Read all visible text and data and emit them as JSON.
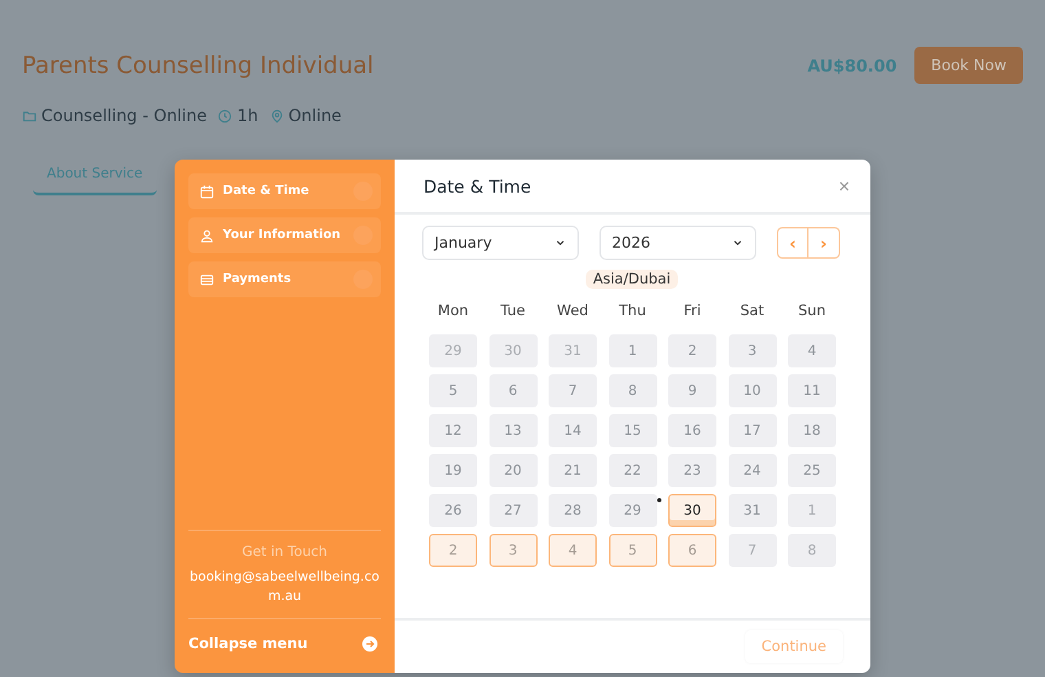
{
  "service": {
    "title": "Parents Counselling Individual",
    "price": "AU$80.00",
    "book_button": "Book Now",
    "category": "Counselling - Online",
    "duration": "1h",
    "location": "Online"
  },
  "tabs": [
    {
      "label": "About Service",
      "selected": true
    }
  ],
  "steps": [
    {
      "label": "Date & Time"
    },
    {
      "label": "Your Information"
    },
    {
      "label": "Payments"
    }
  ],
  "contact": {
    "heading": "Get in Touch",
    "email": "booking@sabeelwellbeing.com.au"
  },
  "collapse": {
    "label": "Collapse menu"
  },
  "panel": {
    "title": "Date & Time",
    "close": "×",
    "month": "January",
    "year": "2026",
    "timezone": "Asia/Dubai",
    "prev": "‹",
    "next": "›",
    "continue": "Continue"
  },
  "weekdays": [
    "Mon",
    "Tue",
    "Wed",
    "Thu",
    "Fri",
    "Sat",
    "Sun"
  ],
  "days": [
    {
      "day": "29",
      "kind": "faded",
      "selected": false,
      "today": false
    },
    {
      "day": "30",
      "kind": "faded",
      "selected": false,
      "today": false
    },
    {
      "day": "31",
      "kind": "faded",
      "selected": false,
      "today": false
    },
    {
      "day": "1",
      "kind": "closed",
      "selected": false,
      "today": false
    },
    {
      "day": "2",
      "kind": "closed",
      "selected": false,
      "today": false
    },
    {
      "day": "3",
      "kind": "closed",
      "selected": false,
      "today": false
    },
    {
      "day": "4",
      "kind": "closed",
      "selected": false,
      "today": false
    },
    {
      "day": "5",
      "kind": "closed",
      "selected": false,
      "today": false
    },
    {
      "day": "6",
      "kind": "closed",
      "selected": false,
      "today": false
    },
    {
      "day": "7",
      "kind": "closed",
      "selected": false,
      "today": false
    },
    {
      "day": "8",
      "kind": "closed",
      "selected": false,
      "today": false
    },
    {
      "day": "9",
      "kind": "closed",
      "selected": false,
      "today": false
    },
    {
      "day": "10",
      "kind": "closed",
      "selected": false,
      "today": false
    },
    {
      "day": "11",
      "kind": "closed",
      "selected": false,
      "today": false
    },
    {
      "day": "12",
      "kind": "closed",
      "selected": false,
      "today": false
    },
    {
      "day": "13",
      "kind": "closed",
      "selected": false,
      "today": false
    },
    {
      "day": "14",
      "kind": "closed",
      "selected": false,
      "today": false
    },
    {
      "day": "15",
      "kind": "closed",
      "selected": false,
      "today": false
    },
    {
      "day": "16",
      "kind": "closed",
      "selected": false,
      "today": false
    },
    {
      "day": "17",
      "kind": "closed",
      "selected": false,
      "today": false
    },
    {
      "day": "18",
      "kind": "closed",
      "selected": false,
      "today": false
    },
    {
      "day": "19",
      "kind": "closed",
      "selected": false,
      "today": false
    },
    {
      "day": "20",
      "kind": "closed",
      "selected": false,
      "today": false
    },
    {
      "day": "21",
      "kind": "closed",
      "selected": false,
      "today": false
    },
    {
      "day": "22",
      "kind": "closed",
      "selected": false,
      "today": false
    },
    {
      "day": "23",
      "kind": "closed",
      "selected": false,
      "today": false
    },
    {
      "day": "24",
      "kind": "closed",
      "selected": false,
      "today": false
    },
    {
      "day": "25",
      "kind": "closed",
      "selected": false,
      "today": false
    },
    {
      "day": "26",
      "kind": "closed",
      "selected": false,
      "today": false
    },
    {
      "day": "27",
      "kind": "closed",
      "selected": false,
      "today": false
    },
    {
      "day": "28",
      "kind": "closed",
      "selected": false,
      "today": false
    },
    {
      "day": "29",
      "kind": "closed",
      "selected": false,
      "today": true
    },
    {
      "day": "30",
      "kind": "open",
      "selected": true,
      "today": false
    },
    {
      "day": "31",
      "kind": "closed",
      "selected": false,
      "today": false
    },
    {
      "day": "1",
      "kind": "faded",
      "selected": false,
      "today": false
    },
    {
      "day": "2",
      "kind": "faded-open",
      "selected": false,
      "today": false
    },
    {
      "day": "3",
      "kind": "faded-open",
      "selected": false,
      "today": false
    },
    {
      "day": "4",
      "kind": "faded-open",
      "selected": false,
      "today": false
    },
    {
      "day": "5",
      "kind": "faded-open",
      "selected": false,
      "today": false
    },
    {
      "day": "6",
      "kind": "faded-open",
      "selected": false,
      "today": false
    },
    {
      "day": "7",
      "kind": "faded",
      "selected": false,
      "today": false
    },
    {
      "day": "8",
      "kind": "faded",
      "selected": false,
      "today": false
    }
  ]
}
